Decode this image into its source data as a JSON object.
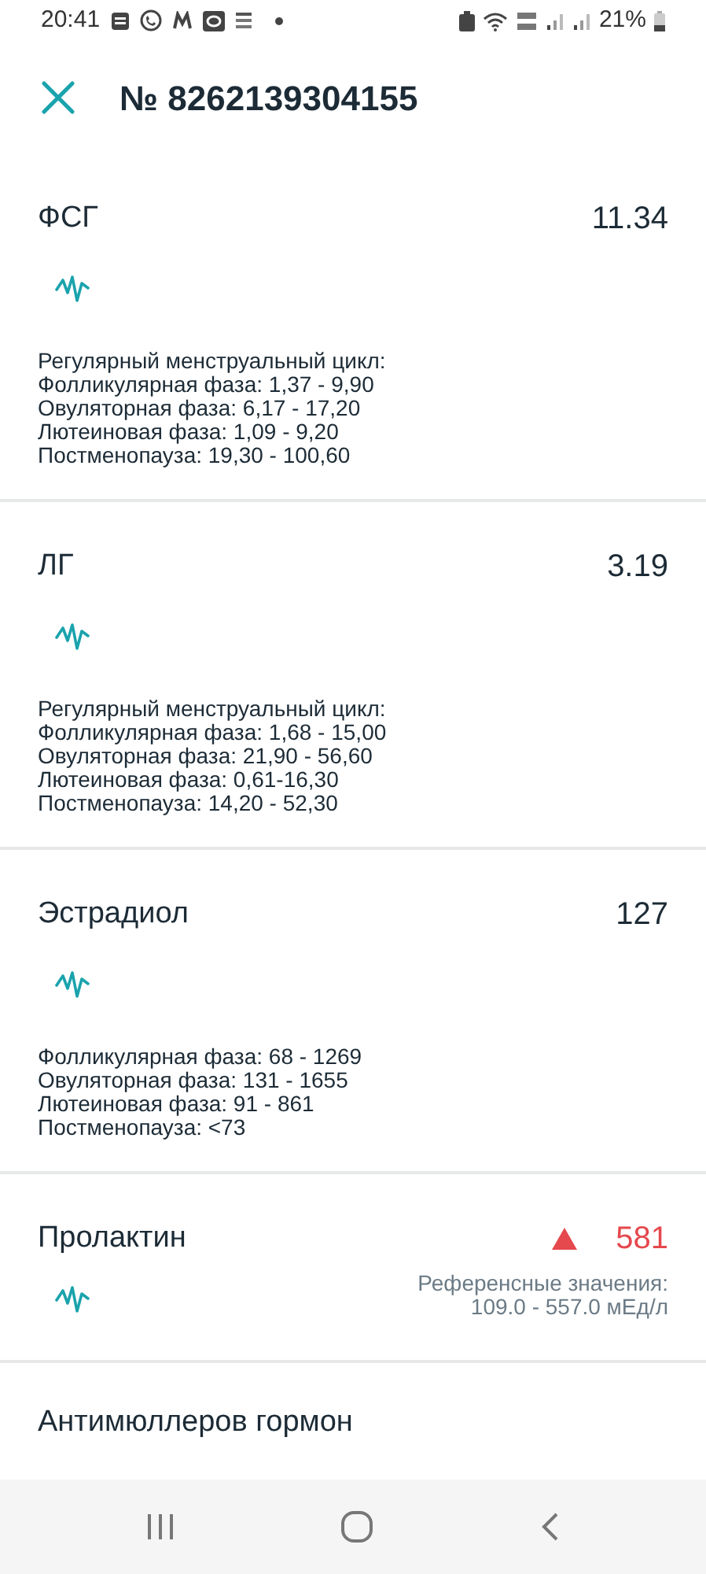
{
  "status_bar": {
    "time": "20:41",
    "battery": "21%"
  },
  "header": {
    "title": "№ 8262139304155"
  },
  "results": [
    {
      "kind": "notes",
      "name": "ФСГ",
      "value": "11.34",
      "high": false,
      "notes": [
        "Регулярный менструальный цикл:",
        "Фолликулярная фаза: 1,37 - 9,90",
        "Овуляторная фаза: 6,17 - 17,20",
        "Лютеиновая фаза: 1,09 - 9,20",
        "Постменопауза: 19,30 - 100,60"
      ]
    },
    {
      "kind": "notes",
      "name": "ЛГ",
      "value": "3.19",
      "high": false,
      "notes": [
        "Регулярный менструальный цикл:",
        "Фолликулярная фаза: 1,68 - 15,00",
        "Овуляторная фаза: 21,90 - 56,60",
        "Лютеиновая фаза: 0,61-16,30",
        "Постменопауза: 14,20 - 52,30"
      ]
    },
    {
      "kind": "notes",
      "name": "Эстрадиол",
      "value": "127",
      "high": false,
      "notes": [
        "Фолликулярная фаза: 68 - 1269",
        "Овуляторная фаза: 131 - 1655",
        "Лютеиновая фаза: 91 - 861",
        "Постменопауза: <73"
      ]
    },
    {
      "kind": "range",
      "name": "Пролактин",
      "value": "581",
      "high": true,
      "reference": [
        "Референсные значения:",
        "109.0 - 557.0 мЕд/л"
      ]
    },
    {
      "kind": "cut",
      "name": "Антимюллеров гормон"
    }
  ]
}
